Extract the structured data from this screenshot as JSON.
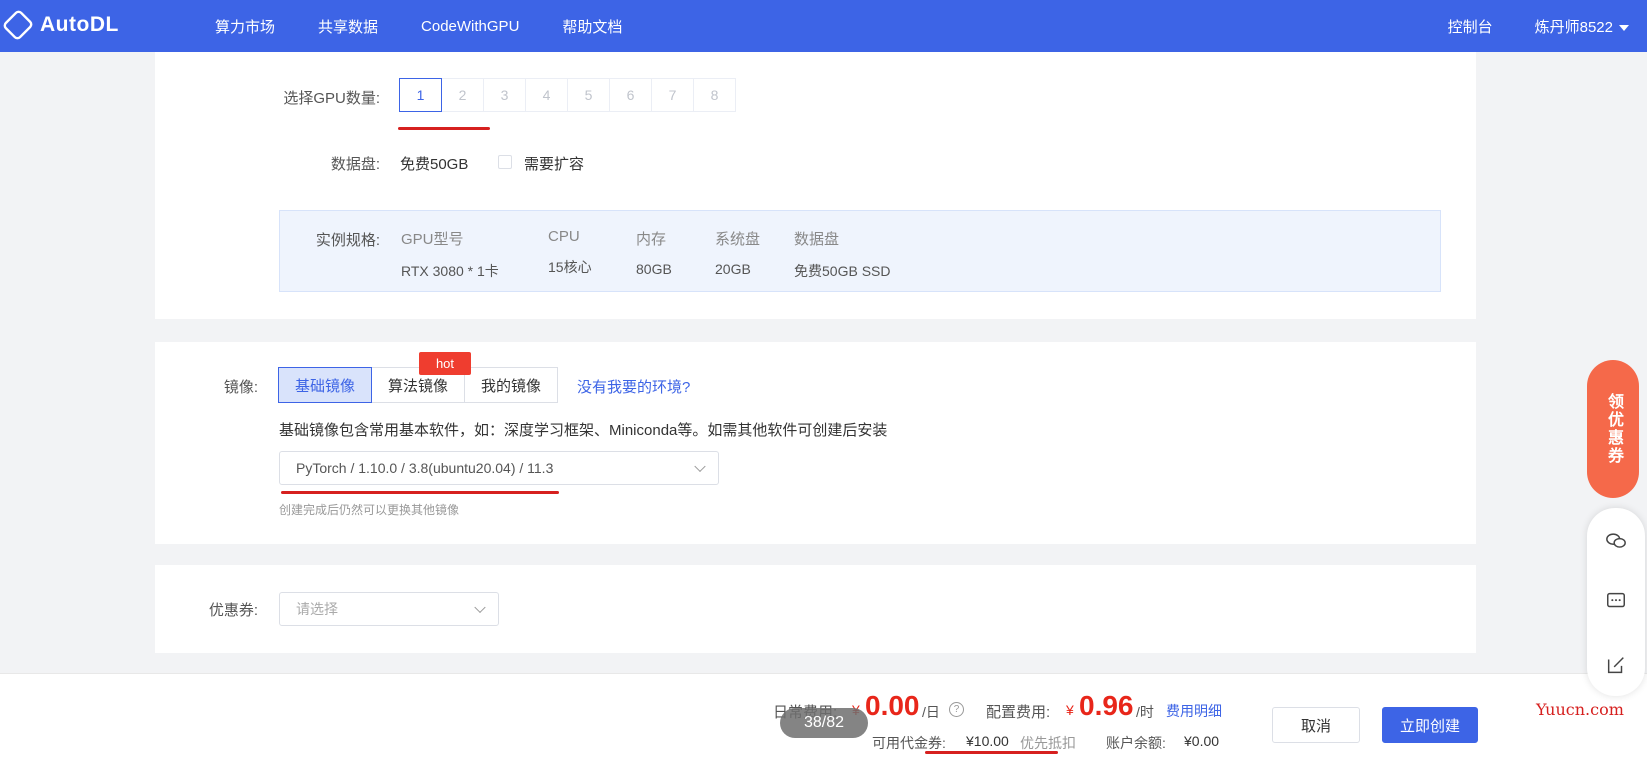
{
  "topbar": {
    "brand": "AutoDL",
    "nav": [
      "算力市场",
      "共享数据",
      "CodeWithGPU",
      "帮助文档"
    ],
    "console": "控制台",
    "user": "炼丹师8522"
  },
  "gpu": {
    "label": "选择GPU数量:",
    "options": [
      "1",
      "2",
      "3",
      "4",
      "5",
      "6",
      "7",
      "8"
    ],
    "selected": "1"
  },
  "disk": {
    "label": "数据盘:",
    "free": "免费50GB",
    "expand_label": "需要扩容"
  },
  "spec": {
    "label": "实例规格:",
    "columns": [
      {
        "head": "GPU型号",
        "value": "RTX 3080 * 1卡"
      },
      {
        "head": "CPU",
        "value": "15核心"
      },
      {
        "head": "内存",
        "value": "80GB"
      },
      {
        "head": "系统盘",
        "value": "20GB"
      },
      {
        "head": "数据盘",
        "value": "免费50GB SSD"
      }
    ]
  },
  "mirror": {
    "label": "镜像:",
    "tabs": [
      "基础镜像",
      "算法镜像",
      "我的镜像"
    ],
    "active_tab": "基础镜像",
    "hot_badge": "hot",
    "missing_env_link": "没有我要的环境?",
    "description": "基础镜像包含常用基本软件，如：深度学习框架、Miniconda等。如需其他软件可创建后安装",
    "selected_image": "PyTorch / 1.10.0 / 3.8(ubuntu20.04) / 11.3",
    "hint": "创建完成后仍然可以更换其他镜像"
  },
  "coupon": {
    "label": "优惠券:",
    "placeholder": "请选择"
  },
  "footer": {
    "daily_fee_label": "日常费用:",
    "daily_symbol": "¥",
    "daily_fee": "0.00",
    "daily_unit": "/日",
    "config_fee_label": "配置费用:",
    "config_symbol": "¥",
    "config_fee": "0.96",
    "config_unit": "/时",
    "fee_detail_link": "费用明细",
    "voucher_label": "可用代金券:",
    "voucher_amount": "¥10.00",
    "voucher_priority": "优先抵扣",
    "balance_label": "账户余额:",
    "balance": "¥0.00",
    "cancel": "取消",
    "create": "立即创建",
    "page_indicator": "38/82"
  },
  "float_coupon": "领优惠券",
  "watermark": "Yuucn.com",
  "colors": {
    "primary": "#3d64e6",
    "price_red": "#e8261a",
    "annotation_red": "#d6201f",
    "float_coupon": "#f5694a"
  }
}
